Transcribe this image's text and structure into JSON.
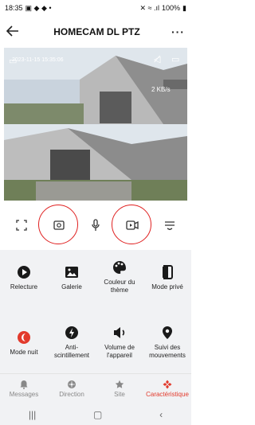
{
  "status_bar": {
    "time": "18:35",
    "battery": "100%"
  },
  "header": {
    "title": "HOMECAM DL PTZ",
    "back_icon": "arrow-left-icon",
    "more_label": "···"
  },
  "video": {
    "timestamp": "2023-11-15 15:35:06",
    "bitrate": "2 KB/s"
  },
  "toolbar": {
    "items": [
      {
        "icon": "fullscreen-icon"
      },
      {
        "icon": "screenshot-icon",
        "highlighted": true
      },
      {
        "icon": "microphone-icon"
      },
      {
        "icon": "record-video-icon",
        "highlighted": true
      },
      {
        "icon": "menu-icon"
      }
    ]
  },
  "features": [
    {
      "label": "Relecture",
      "icon": "playback-icon"
    },
    {
      "label": "Galerie",
      "icon": "gallery-icon"
    },
    {
      "label": "Couleur du thème",
      "icon": "palette-icon"
    },
    {
      "label": "Mode privé",
      "icon": "privacy-icon"
    },
    {
      "label": "Mode nuit",
      "icon": "night-mode-icon"
    },
    {
      "label": "Anti-scintillement",
      "icon": "anti-flicker-icon"
    },
    {
      "label": "Volume de l'appareil",
      "icon": "volume-icon"
    },
    {
      "label": "Suivi des mouvements",
      "icon": "motion-tracking-icon"
    }
  ],
  "bottom_nav": [
    {
      "label": "Messages",
      "icon": "bell-icon"
    },
    {
      "label": "Direction",
      "icon": "direction-icon"
    },
    {
      "label": "Site",
      "icon": "star-icon"
    },
    {
      "label": "Caractéristique",
      "icon": "features-icon",
      "active": true
    }
  ],
  "colors": {
    "accent": "#e23a2c",
    "highlight_circle": "#e02020"
  }
}
